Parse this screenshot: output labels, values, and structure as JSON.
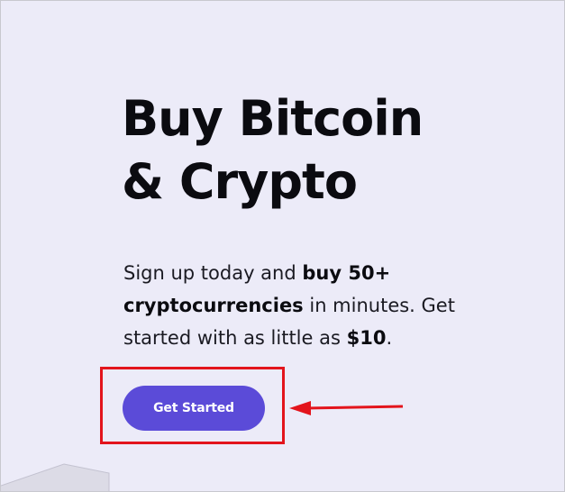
{
  "hero": {
    "title_line1": "Buy Bitcoin",
    "title_line2": "& Crypto",
    "subtitle": {
      "part1": "Sign up today and ",
      "bold1": "buy 50+ cryptocurrencies",
      "part2": " in minutes. Get started with as little as ",
      "bold2": "$10",
      "part3": "."
    },
    "cta_label": "Get Started"
  },
  "colors": {
    "background": "#ecebf8",
    "cta": "#5b4bd8",
    "annotation": "#e3141c"
  }
}
